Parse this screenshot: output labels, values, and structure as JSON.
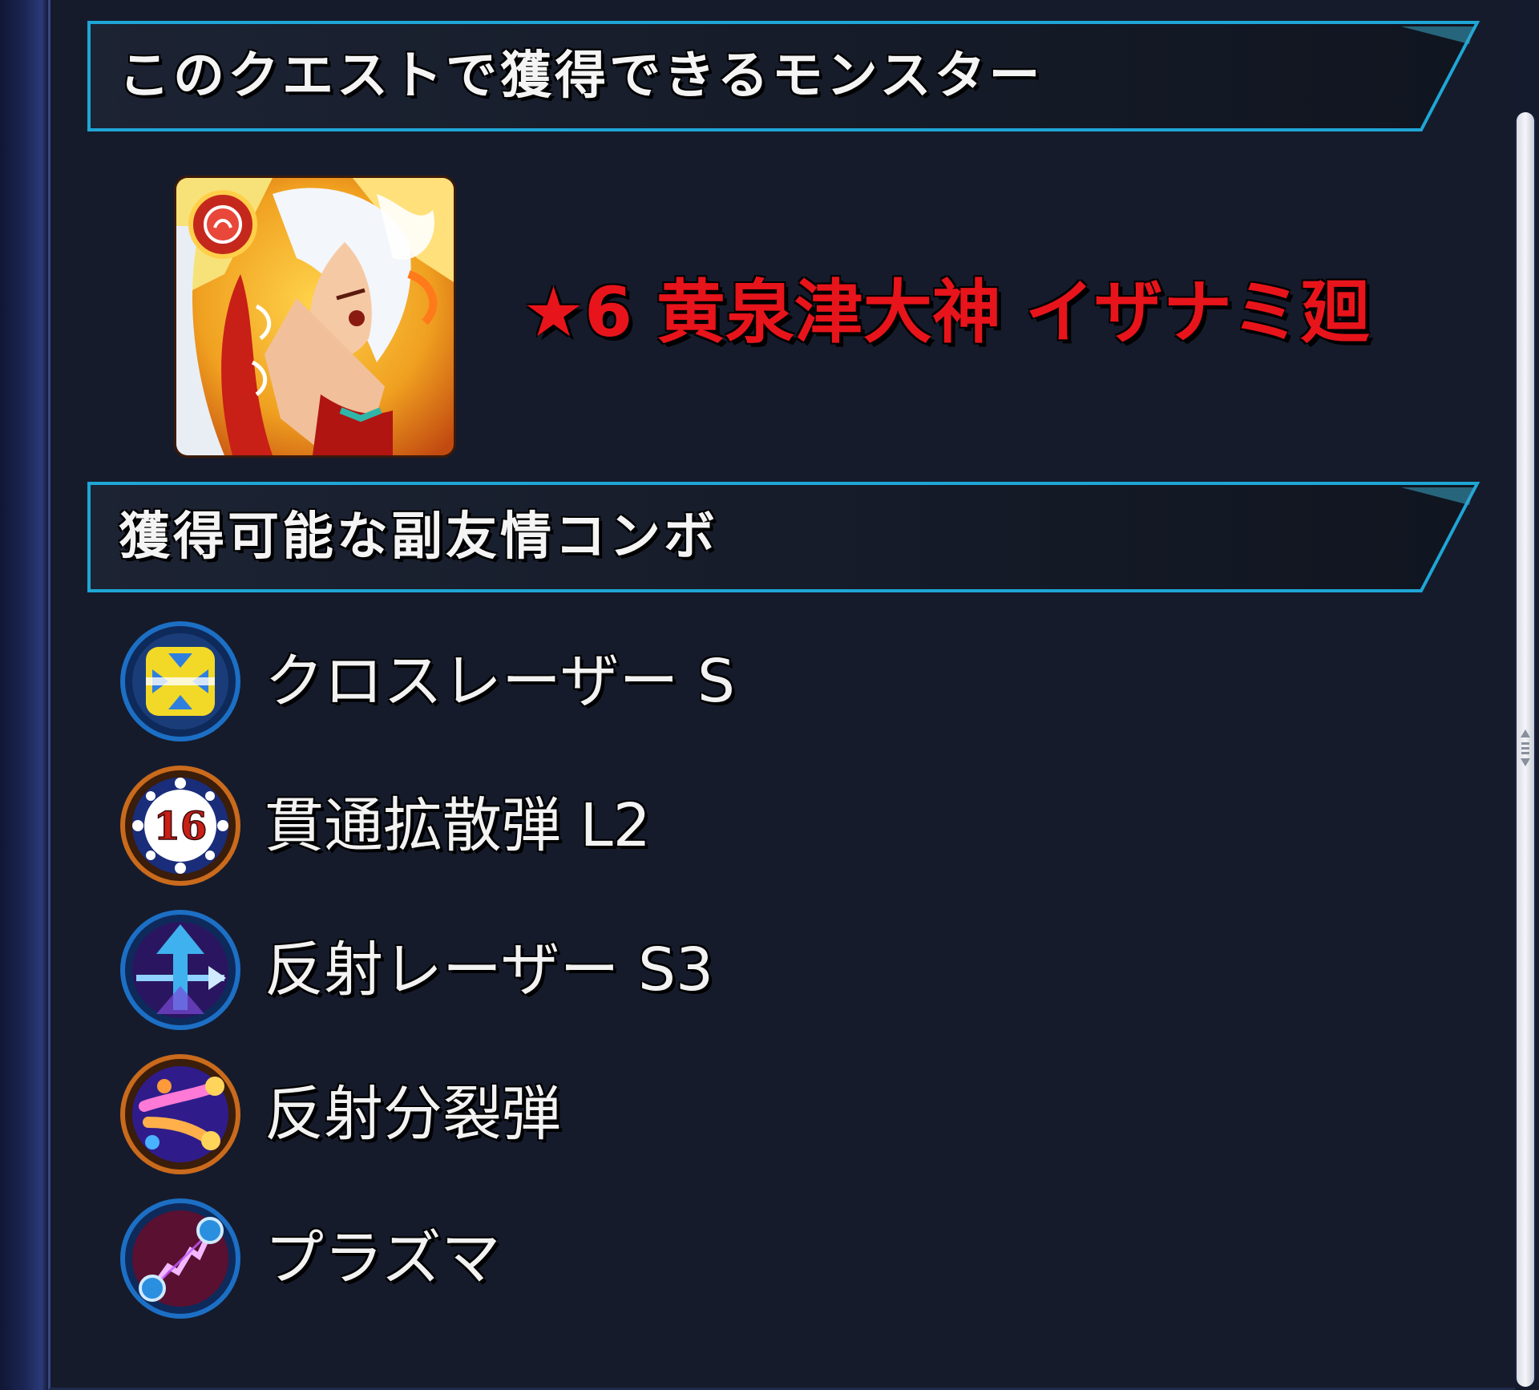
{
  "sections": {
    "monster": {
      "title": "このクエストで獲得できるモンスター",
      "monster_name": "★6 黄泉津大神 イザナミ廻"
    },
    "combos": {
      "title": "獲得可能な副友情コンボ",
      "items": [
        {
          "label": "クロスレーザー S",
          "icon": "cross-laser-icon"
        },
        {
          "label": "貫通拡散弾 L2",
          "icon": "pierce-spread-shot-icon"
        },
        {
          "label": "反射レーザー S3",
          "icon": "reflect-laser-icon"
        },
        {
          "label": "反射分裂弾",
          "icon": "reflect-split-shot-icon"
        },
        {
          "label": "プラズマ",
          "icon": "plasma-icon"
        }
      ]
    }
  },
  "badge_number": "16",
  "colors": {
    "panel_bg": "#151b2b",
    "header_border": "#1fa6d6",
    "monster_name": "#e8141b",
    "text": "#f2f2f2"
  }
}
